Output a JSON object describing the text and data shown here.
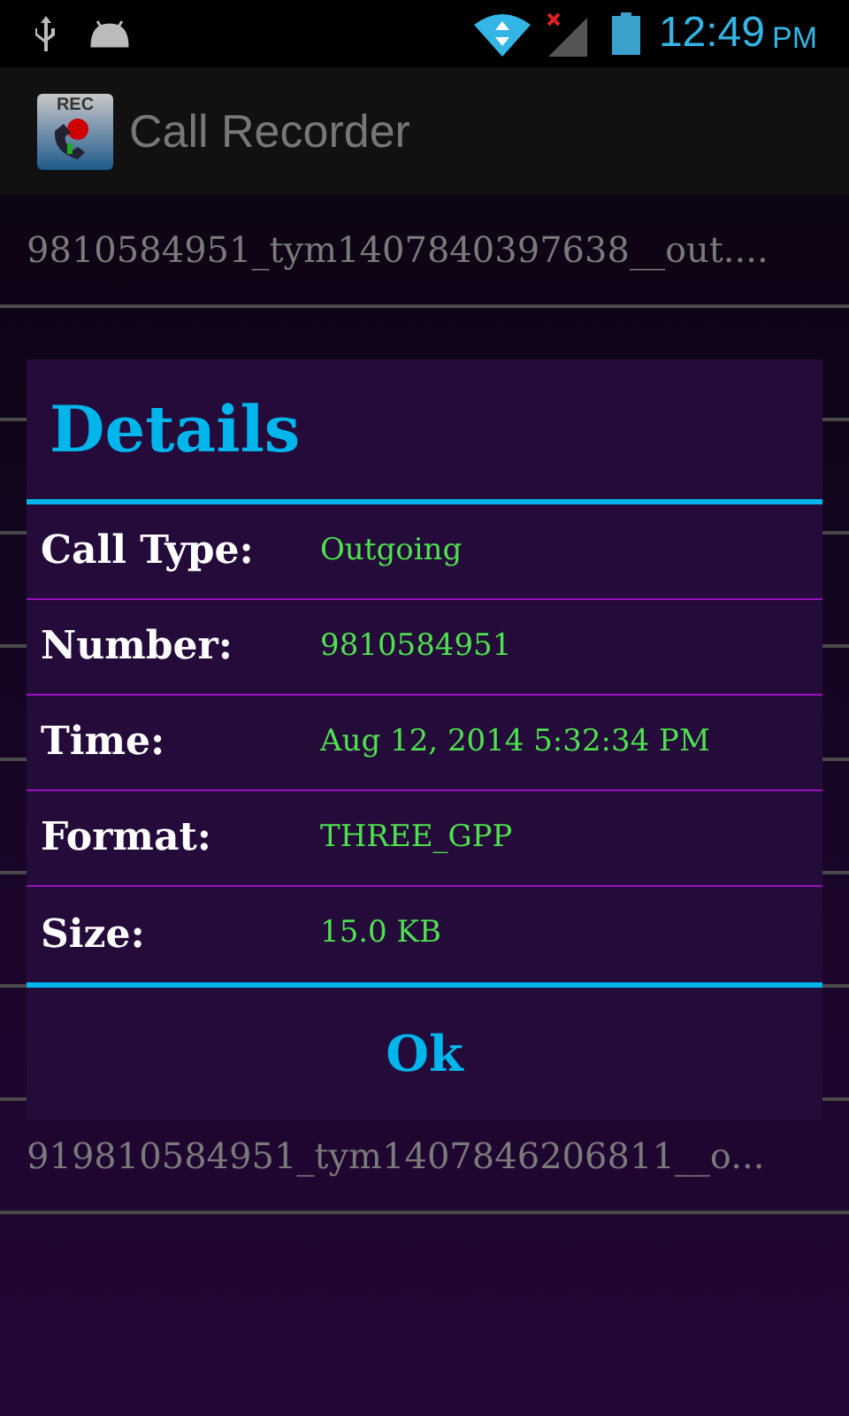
{
  "status_bar": {
    "time": "12:49",
    "meridiem": "PM"
  },
  "app_bar": {
    "icon_label": "REC",
    "title": "Call Recorder"
  },
  "recordings_above": [
    {
      "name": "9810584951_tym1407840397638__out...."
    }
  ],
  "recordings_below": [
    {
      "name": "919810584951_tym1407846206811__o..."
    }
  ],
  "dialog": {
    "title": "Details",
    "fields": [
      {
        "label": "Call Type:",
        "value": "Outgoing"
      },
      {
        "label": "Number:",
        "value": "9810584951"
      },
      {
        "label": "Time:",
        "value": "Aug 12, 2014 5:32:34 PM"
      },
      {
        "label": "Format:",
        "value": "THREE_GPP"
      },
      {
        "label": "Size:",
        "value": "15.0 KB"
      }
    ],
    "button": "Ok"
  }
}
